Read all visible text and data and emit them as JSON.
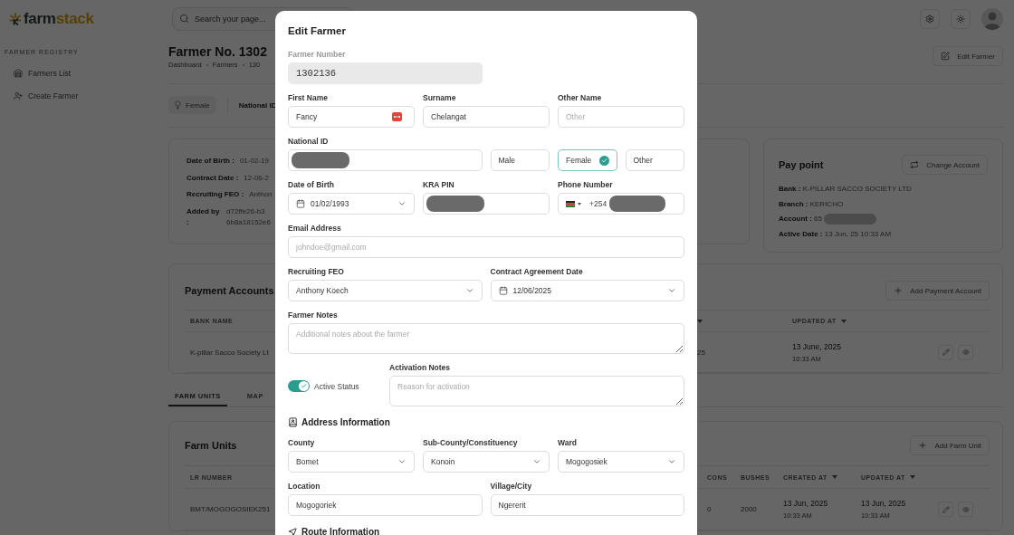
{
  "sidebar": {
    "logo": {
      "primary": "farm",
      "accent": "stack"
    },
    "section_title": "FARMER REGISTRY",
    "items": [
      {
        "label": "Farmers List"
      },
      {
        "label": "Create Farmer"
      }
    ]
  },
  "topbar": {
    "search": {
      "placeholder": "Search your page..."
    }
  },
  "header": {
    "title": "Farmer No. 1302",
    "breadcrumb": [
      "Dashboard",
      "Farmers",
      "130"
    ],
    "edit_button": "Edit Farmer"
  },
  "chips": {
    "gender": "Female",
    "national_id_label": "National ID"
  },
  "details": [
    {
      "label": "Date of Birth :",
      "value": [
        "01-02-19"
      ]
    },
    {
      "label": "Contract Date :",
      "value": [
        "12-06-2"
      ]
    },
    {
      "label": "Recruiting FEO :",
      "value": [
        "Anthon"
      ]
    },
    {
      "label": "Added by :",
      "value": [
        "d72ffe26-b3",
        "6b8a18152e6"
      ]
    }
  ],
  "pay_point": {
    "title": "Pay point",
    "button": "Change Account",
    "lines": [
      {
        "text": "**Bank :** K-PILLAR SACCO SOCIETY LTD"
      },
      {
        "text": "**Branch :** KERICHO"
      },
      {
        "text": "**Account :** 65",
        "redacted": true
      },
      {
        "text": "**Active Date :** 13 Jun, 25 10:33 AM"
      }
    ]
  },
  "payment_accounts": {
    "title": "Payment Accounts",
    "add_button": "Add Payment Account",
    "columns": [
      {
        "label": "BANK NAME"
      },
      {
        "sortable": true
      },
      {
        "label": "UPDATED AT",
        "sortable": true
      }
    ],
    "rows": [
      {
        "cells": [
          "K-pillar Sacco Society Lt",
          "25",
          {
            "date": "13 June, 2025",
            "time": "10:33 AM"
          }
        ]
      }
    ]
  },
  "tabs": [
    {
      "label": "FARM UNITS",
      "selected": true
    },
    {
      "label": "MAP",
      "selected": false
    }
  ],
  "farm_units": {
    "title": "Farm Units",
    "add_button": "Add Farm Unit",
    "columns": [
      {
        "label": "LR NUMBER"
      },
      {
        "label": "CONS"
      },
      {
        "label": "BUSHES"
      },
      {
        "label": "CREATED AT",
        "sortable": true
      },
      {
        "label": "UPDATED AT",
        "sortable": true
      }
    ],
    "rows": [
      {
        "cells": [
          "BMT/MOGOGOSIEK251",
          "0",
          "2000",
          {
            "date": "13 Jun, 2025",
            "time": "10:33 AM"
          },
          {
            "date": "13 Jun, 2025",
            "time": "10:33 AM"
          }
        ]
      }
    ]
  },
  "modal": {
    "title": "Edit Farmer",
    "rows": [
      {
        "kind": "fields",
        "fields": [
          {
            "kind": "text",
            "label": "Farmer Number",
            "value": "1302136",
            "disabled": true
          }
        ]
      },
      {
        "kind": "fields",
        "fields": [
          {
            "kind": "text",
            "label": "First Name",
            "value": "Fancy",
            "has_autofill_icon": true
          },
          {
            "kind": "text",
            "label": "Surname",
            "value": "Chelangat"
          },
          {
            "kind": "text",
            "label": "Other Name",
            "placeholder": "Other"
          }
        ]
      },
      {
        "kind": "fields",
        "fields": [
          {
            "kind": "redacted",
            "label": "National ID"
          },
          {
            "kind": "choice",
            "options": [
              {
                "label": "Male",
                "selected": false
              },
              {
                "label": "Female",
                "selected": true
              },
              {
                "label": "Other",
                "selected": false
              }
            ]
          }
        ]
      },
      {
        "kind": "fields",
        "fields": [
          {
            "kind": "date",
            "label": "Date of Birth",
            "value": "01/02/1993"
          },
          {
            "kind": "redacted",
            "label": "KRA PIN"
          },
          {
            "kind": "phone",
            "label": "Phone Number",
            "value": "+254"
          }
        ]
      },
      {
        "kind": "fields",
        "fields": [
          {
            "kind": "text",
            "label": "Email Address",
            "placeholder": "johndoe@gmail.com"
          }
        ]
      },
      {
        "kind": "fields",
        "fields": [
          {
            "kind": "select",
            "label": "Recruiting FEO",
            "value": "Anthony Koech"
          },
          {
            "kind": "date",
            "label": "Contract Agreement Date",
            "value": "12/06/2025"
          }
        ]
      },
      {
        "kind": "fields",
        "fields": [
          {
            "kind": "textarea",
            "label": "Farmer Notes",
            "placeholder": "Additional notes about the farmer"
          }
        ]
      },
      {
        "kind": "fields",
        "fields": [
          {
            "kind": "toggle",
            "label": "Active Status",
            "on": true
          },
          {
            "kind": "textarea",
            "label": "Activation Notes",
            "placeholder": "Reason for activation"
          }
        ]
      },
      {
        "kind": "heading",
        "text": "Address Information"
      },
      {
        "kind": "fields",
        "fields": [
          {
            "kind": "select",
            "label": "County",
            "value": "Bomet"
          },
          {
            "kind": "select",
            "label": "Sub-County/Constituency",
            "value": "Konoin"
          },
          {
            "kind": "select",
            "label": "Ward",
            "value": "Mogogosiek"
          }
        ]
      },
      {
        "kind": "fields",
        "fields": [
          {
            "kind": "text",
            "label": "Location",
            "value": "Mogogoriek"
          },
          {
            "kind": "text",
            "label": "Village/City",
            "value": "Ngererit"
          }
        ]
      },
      {
        "kind": "heading",
        "text": "Route Information"
      }
    ]
  }
}
